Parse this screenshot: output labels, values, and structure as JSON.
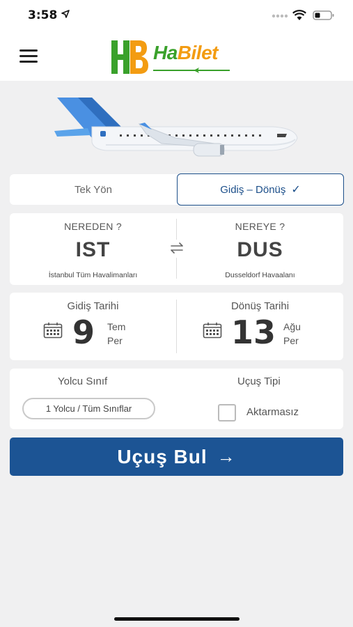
{
  "status_bar": {
    "time": "3:58"
  },
  "header": {
    "logo_text": "HaBilet",
    "brand_colors": {
      "green": "#3aa12b",
      "orange": "#f39c12"
    }
  },
  "trip_type": {
    "one_way_label": "Tek Yön",
    "round_trip_label": "Gidiş – Dönüş",
    "selected": "round_trip"
  },
  "route": {
    "from_label": "NEREDEN ?",
    "from_code": "IST",
    "from_airport": "İstanbul Tüm Havalimanları",
    "to_label": "NEREYE ?",
    "to_code": "DUS",
    "to_airport": "Dusseldorf Havaalanı"
  },
  "dates": {
    "departure_label": "Gidiş Tarihi",
    "departure_day": "9",
    "departure_month": "Tem",
    "departure_weekday": "Per",
    "return_label": "Dönüş Tarihi",
    "return_day": "13",
    "return_month": "Ağu",
    "return_weekday": "Per"
  },
  "options": {
    "passenger_class_label": "Yolcu Sınıf",
    "passenger_class_value": "1 Yolcu / Tüm Sınıflar",
    "flight_type_label": "Uçuş Tipi",
    "nonstop_label": "Aktarmasız",
    "nonstop_checked": false
  },
  "search_button": {
    "label": "Uçuş Bul",
    "arrow": "→",
    "color": "#1c5494"
  },
  "icons": {
    "menu": "menu-icon",
    "swap": "swap-icon",
    "calendar": "calendar-icon",
    "check": "check-icon"
  }
}
